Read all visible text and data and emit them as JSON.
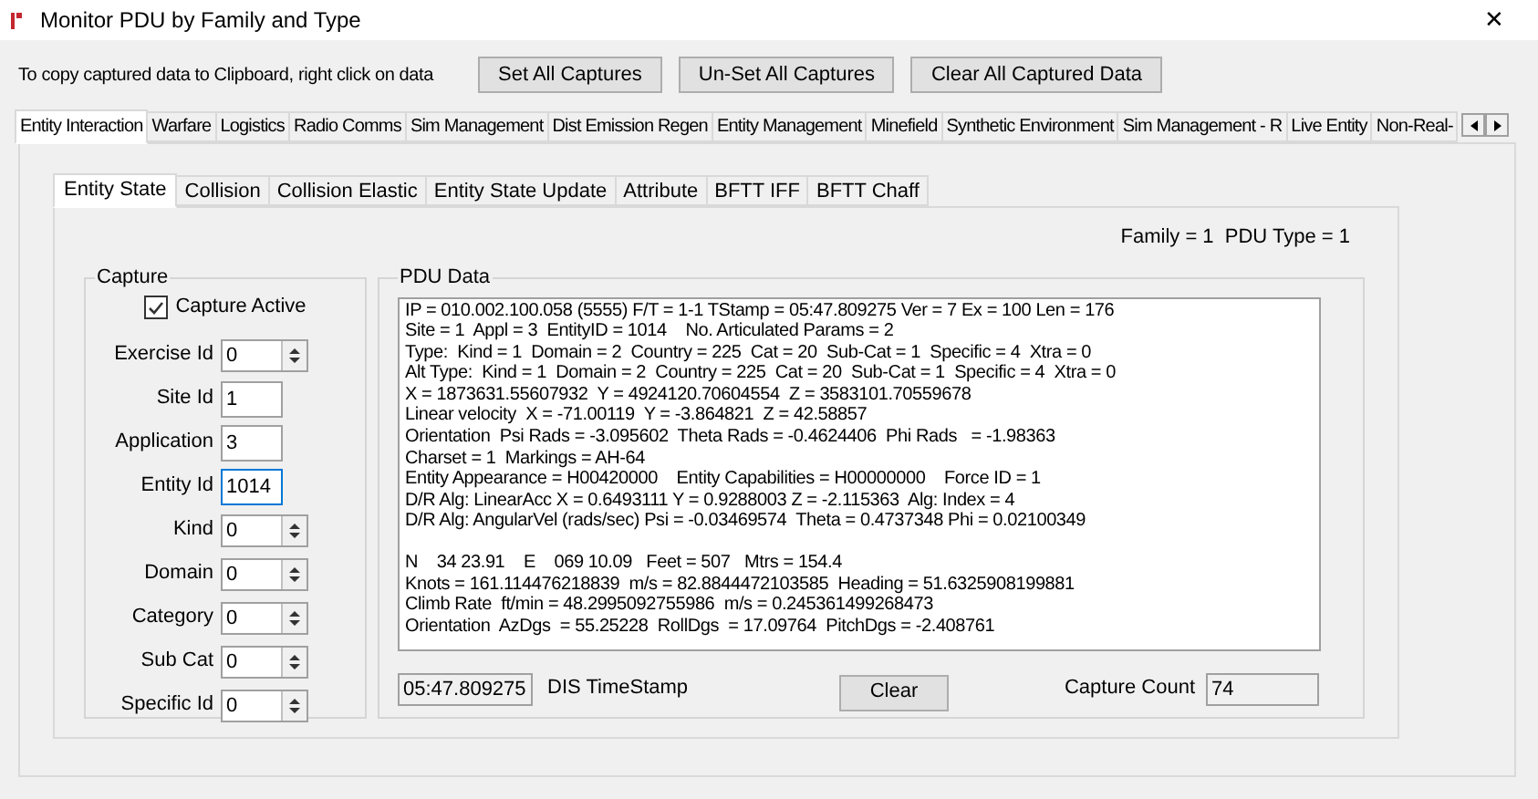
{
  "window": {
    "title": "Monitor PDU by Family and Type",
    "close": "✕"
  },
  "toolbar": {
    "hint": "To copy captured data to Clipboard, right click on data",
    "buttons": [
      "Set All Captures",
      "Un-Set All Captures",
      "Clear All Captured Data"
    ]
  },
  "tabs": [
    {
      "label": "Entity Interaction",
      "selected": true
    },
    {
      "label": "Warfare",
      "selected": false
    },
    {
      "label": "Logistics",
      "selected": false
    },
    {
      "label": "Radio Comms",
      "selected": false
    },
    {
      "label": "Sim Management",
      "selected": false
    },
    {
      "label": "Dist Emission Regen",
      "selected": false
    },
    {
      "label": "Entity Management",
      "selected": false
    },
    {
      "label": "Minefield",
      "selected": false
    },
    {
      "label": "Synthetic Environment",
      "selected": false
    },
    {
      "label": "Sim Management - R",
      "selected": false
    },
    {
      "label": "Live Entity",
      "selected": false
    },
    {
      "label": "Non-Real-",
      "selected": false
    }
  ],
  "sub_tabs": [
    {
      "label": "Entity State",
      "selected": true
    },
    {
      "label": "Collision",
      "selected": false
    },
    {
      "label": "Collision Elastic",
      "selected": false
    },
    {
      "label": "Entity State Update",
      "selected": false
    },
    {
      "label": "Attribute",
      "selected": false
    },
    {
      "label": "BFTT IFF",
      "selected": false
    },
    {
      "label": "BFTT Chaff",
      "selected": false
    }
  ],
  "family_info": "Family = 1  PDU Type = 1",
  "capture": {
    "title": "Capture",
    "capture_active": {
      "label": "Capture Active",
      "checked": true
    },
    "fields": [
      {
        "label": "Exercise Id",
        "value": "0",
        "kind": "spinner",
        "focused": false
      },
      {
        "label": "Site Id",
        "value": "1",
        "kind": "text",
        "focused": false
      },
      {
        "label": "Application",
        "value": "3",
        "kind": "text",
        "focused": false
      },
      {
        "label": "Entity Id",
        "value": "1014",
        "kind": "text",
        "focused": true
      },
      {
        "label": "Kind",
        "value": "0",
        "kind": "spinner",
        "focused": false
      },
      {
        "label": "Domain",
        "value": "0",
        "kind": "spinner",
        "focused": false
      },
      {
        "label": "Category",
        "value": "0",
        "kind": "spinner",
        "focused": false
      },
      {
        "label": "Sub Cat",
        "value": "0",
        "kind": "spinner",
        "focused": false
      },
      {
        "label": "Specific Id",
        "value": "0",
        "kind": "spinner",
        "focused": false
      }
    ]
  },
  "pdu_data": {
    "title": "PDU Data",
    "blocks": [
      [
        "IP = 010.002.100.058 (5555) F/T = 1-1 TStamp = 05:47.809275 Ver = 7 Ex = 100 Len = 176",
        "Site = 1  Appl = 3  EntityID = 1014    No. Articulated Params = 2",
        "Type:  Kind = 1  Domain = 2  Country = 225  Cat = 20  Sub-Cat = 1  Specific = 4  Xtra = 0",
        "Alt Type:  Kind = 1  Domain = 2  Country = 225  Cat = 20  Sub-Cat = 1  Specific = 4  Xtra = 0",
        "X = 1873631.55607932  Y = 4924120.70604554  Z = 3583101.70559678",
        "Linear velocity  X = -71.00119  Y = -3.864821  Z = 42.58857",
        "Orientation  Psi Rads = -3.095602  Theta Rads = -0.4624406  Phi Rads   = -1.98363",
        "Charset = 1  Markings = AH-64",
        "Entity Appearance = H00420000    Entity Capabilities = H00000000    Force ID = 1",
        "D/R Alg: LinearAcc X = 0.6493111 Y = 0.9288003 Z = -2.115363  Alg: Index = 4",
        "D/R Alg: AngularVel (rads/sec) Psi = -0.03469574  Theta = 0.4737348 Phi = 0.02100349"
      ],
      [
        "N    34 23.91    E    069 10.09   Feet = 507   Mtrs = 154.4",
        "Knots = 161.114476218839  m/s = 82.8844472103585  Heading = 51.6325908199881",
        "Climb Rate  ft/min = 48.2995092755986  m/s = 0.245361499268473",
        "Orientation  AzDgs  = 55.25228  RollDgs  = 17.09764  PitchDgs = -2.408761"
      ]
    ],
    "timestamp": "05:47.809275",
    "timestamp_label": "DIS TimeStamp",
    "clear": "Clear",
    "capture_count_label": "Capture Count",
    "capture_count": "74"
  }
}
